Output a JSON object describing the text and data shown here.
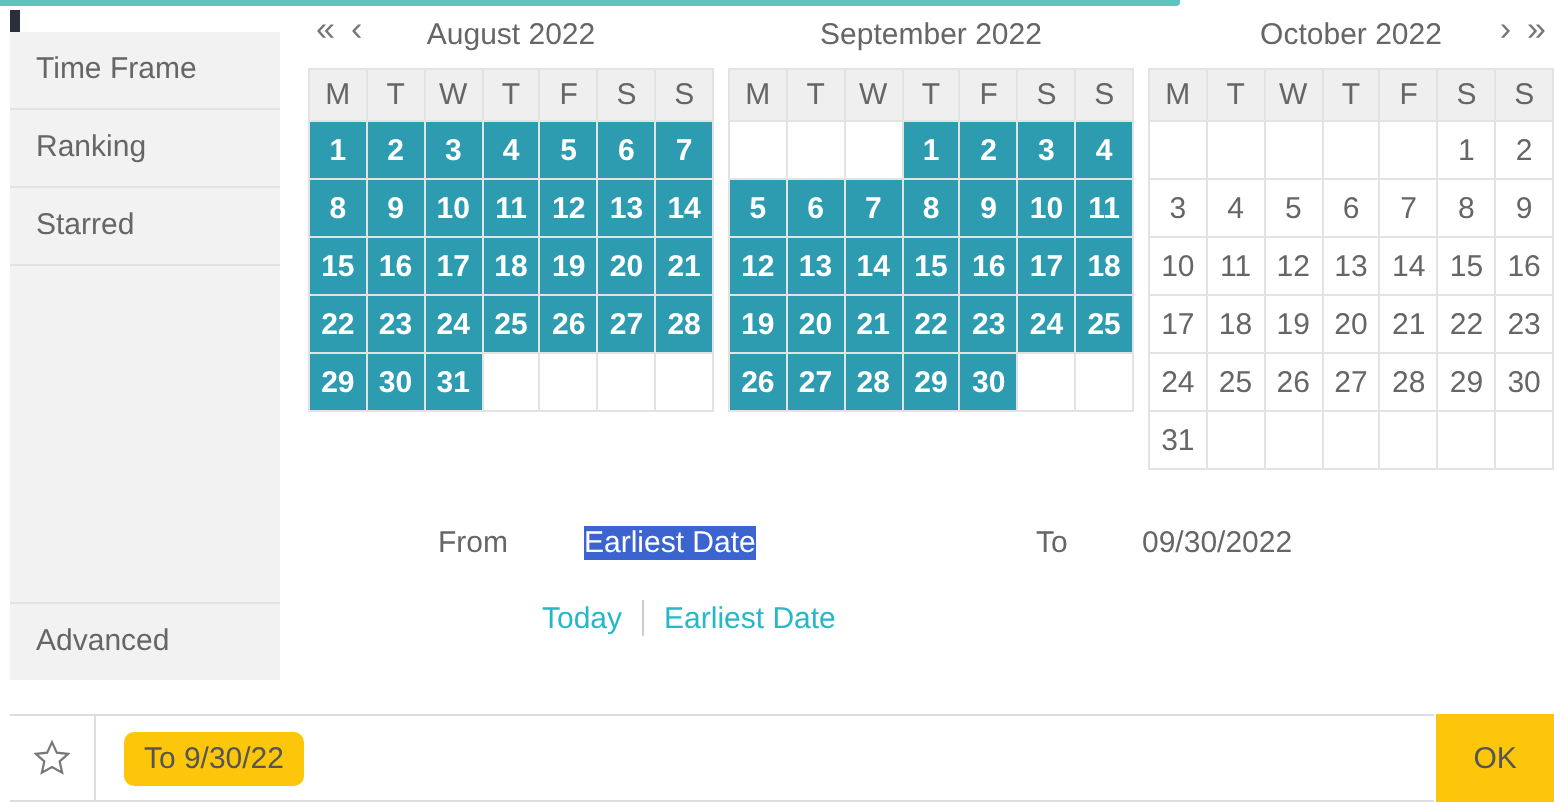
{
  "sidebar": {
    "items": [
      {
        "label": "Time Frame"
      },
      {
        "label": "Ranking"
      },
      {
        "label": "Starred"
      }
    ],
    "footer_item": "Advanced"
  },
  "calendar": {
    "nav": {
      "prev_year": "«",
      "prev_month": "‹",
      "next_month": "›",
      "next_year": "»"
    },
    "months": [
      {
        "title": "August 2022",
        "weekdays": [
          "M",
          "T",
          "W",
          "T",
          "F",
          "S",
          "S"
        ],
        "weeks": [
          [
            {
              "kind": "day",
              "day": "1",
              "selected": true
            },
            {
              "kind": "day",
              "day": "2",
              "selected": true
            },
            {
              "kind": "day",
              "day": "3",
              "selected": true
            },
            {
              "kind": "day",
              "day": "4",
              "selected": true
            },
            {
              "kind": "day",
              "day": "5",
              "selected": true
            },
            {
              "kind": "day",
              "day": "6",
              "selected": true
            },
            {
              "kind": "day",
              "day": "7",
              "selected": true
            }
          ],
          [
            {
              "kind": "day",
              "day": "8",
              "selected": true
            },
            {
              "kind": "day",
              "day": "9",
              "selected": true
            },
            {
              "kind": "day",
              "day": "10",
              "selected": true
            },
            {
              "kind": "day",
              "day": "11",
              "selected": true
            },
            {
              "kind": "day",
              "day": "12",
              "selected": true
            },
            {
              "kind": "day",
              "day": "13",
              "selected": true
            },
            {
              "kind": "day",
              "day": "14",
              "selected": true
            }
          ],
          [
            {
              "kind": "day",
              "day": "15",
              "selected": true
            },
            {
              "kind": "day",
              "day": "16",
              "selected": true
            },
            {
              "kind": "day",
              "day": "17",
              "selected": true
            },
            {
              "kind": "day",
              "day": "18",
              "selected": true
            },
            {
              "kind": "day",
              "day": "19",
              "selected": true
            },
            {
              "kind": "day",
              "day": "20",
              "selected": true
            },
            {
              "kind": "day",
              "day": "21",
              "selected": true
            }
          ],
          [
            {
              "kind": "day",
              "day": "22",
              "selected": true
            },
            {
              "kind": "day",
              "day": "23",
              "selected": true
            },
            {
              "kind": "day",
              "day": "24",
              "selected": true
            },
            {
              "kind": "day",
              "day": "25",
              "selected": true
            },
            {
              "kind": "day",
              "day": "26",
              "selected": true
            },
            {
              "kind": "day",
              "day": "27",
              "selected": true
            },
            {
              "kind": "day",
              "day": "28",
              "selected": true
            }
          ],
          [
            {
              "kind": "day",
              "day": "29",
              "selected": true
            },
            {
              "kind": "day",
              "day": "30",
              "selected": true
            },
            {
              "kind": "day",
              "day": "31",
              "selected": true
            },
            {
              "kind": "blank"
            },
            {
              "kind": "blank"
            },
            {
              "kind": "blank"
            },
            {
              "kind": "blank"
            }
          ]
        ]
      },
      {
        "title": "September 2022",
        "weekdays": [
          "M",
          "T",
          "W",
          "T",
          "F",
          "S",
          "S"
        ],
        "weeks": [
          [
            {
              "kind": "blank"
            },
            {
              "kind": "blank"
            },
            {
              "kind": "blank"
            },
            {
              "kind": "day",
              "day": "1",
              "selected": true
            },
            {
              "kind": "day",
              "day": "2",
              "selected": true
            },
            {
              "kind": "day",
              "day": "3",
              "selected": true
            },
            {
              "kind": "day",
              "day": "4",
              "selected": true
            }
          ],
          [
            {
              "kind": "day",
              "day": "5",
              "selected": true
            },
            {
              "kind": "day",
              "day": "6",
              "selected": true
            },
            {
              "kind": "day",
              "day": "7",
              "selected": true
            },
            {
              "kind": "day",
              "day": "8",
              "selected": true
            },
            {
              "kind": "day",
              "day": "9",
              "selected": true
            },
            {
              "kind": "day",
              "day": "10",
              "selected": true
            },
            {
              "kind": "day",
              "day": "11",
              "selected": true
            }
          ],
          [
            {
              "kind": "day",
              "day": "12",
              "selected": true
            },
            {
              "kind": "day",
              "day": "13",
              "selected": true
            },
            {
              "kind": "day",
              "day": "14",
              "selected": true
            },
            {
              "kind": "day",
              "day": "15",
              "selected": true
            },
            {
              "kind": "day",
              "day": "16",
              "selected": true
            },
            {
              "kind": "day",
              "day": "17",
              "selected": true
            },
            {
              "kind": "day",
              "day": "18",
              "selected": true
            }
          ],
          [
            {
              "kind": "day",
              "day": "19",
              "selected": true
            },
            {
              "kind": "day",
              "day": "20",
              "selected": true
            },
            {
              "kind": "day",
              "day": "21",
              "selected": true
            },
            {
              "kind": "day",
              "day": "22",
              "selected": true
            },
            {
              "kind": "day",
              "day": "23",
              "selected": true
            },
            {
              "kind": "day",
              "day": "24",
              "selected": true
            },
            {
              "kind": "day",
              "day": "25",
              "selected": true
            }
          ],
          [
            {
              "kind": "day",
              "day": "26",
              "selected": true
            },
            {
              "kind": "day",
              "day": "27",
              "selected": true
            },
            {
              "kind": "day",
              "day": "28",
              "selected": true
            },
            {
              "kind": "day",
              "day": "29",
              "selected": true
            },
            {
              "kind": "day",
              "day": "30",
              "selected": true
            },
            {
              "kind": "blank"
            },
            {
              "kind": "blank"
            }
          ]
        ]
      },
      {
        "title": "October 2022",
        "weekdays": [
          "M",
          "T",
          "W",
          "T",
          "F",
          "S",
          "S"
        ],
        "weeks": [
          [
            {
              "kind": "blank"
            },
            {
              "kind": "blank"
            },
            {
              "kind": "blank"
            },
            {
              "kind": "blank"
            },
            {
              "kind": "blank"
            },
            {
              "kind": "day",
              "day": "1",
              "selected": false
            },
            {
              "kind": "day",
              "day": "2",
              "selected": false
            }
          ],
          [
            {
              "kind": "day",
              "day": "3",
              "selected": false
            },
            {
              "kind": "day",
              "day": "4",
              "selected": false
            },
            {
              "kind": "day",
              "day": "5",
              "selected": false
            },
            {
              "kind": "day",
              "day": "6",
              "selected": false
            },
            {
              "kind": "day",
              "day": "7",
              "selected": false
            },
            {
              "kind": "day",
              "day": "8",
              "selected": false
            },
            {
              "kind": "day",
              "day": "9",
              "selected": false
            }
          ],
          [
            {
              "kind": "day",
              "day": "10",
              "selected": false
            },
            {
              "kind": "day",
              "day": "11",
              "selected": false
            },
            {
              "kind": "day",
              "day": "12",
              "selected": false
            },
            {
              "kind": "day",
              "day": "13",
              "selected": false
            },
            {
              "kind": "day",
              "day": "14",
              "selected": false
            },
            {
              "kind": "day",
              "day": "15",
              "selected": false
            },
            {
              "kind": "day",
              "day": "16",
              "selected": false
            }
          ],
          [
            {
              "kind": "day",
              "day": "17",
              "selected": false
            },
            {
              "kind": "day",
              "day": "18",
              "selected": false
            },
            {
              "kind": "day",
              "day": "19",
              "selected": false
            },
            {
              "kind": "day",
              "day": "20",
              "selected": false
            },
            {
              "kind": "day",
              "day": "21",
              "selected": false
            },
            {
              "kind": "day",
              "day": "22",
              "selected": false
            },
            {
              "kind": "day",
              "day": "23",
              "selected": false
            }
          ],
          [
            {
              "kind": "day",
              "day": "24",
              "selected": false
            },
            {
              "kind": "day",
              "day": "25",
              "selected": false
            },
            {
              "kind": "day",
              "day": "26",
              "selected": false
            },
            {
              "kind": "day",
              "day": "27",
              "selected": false
            },
            {
              "kind": "day",
              "day": "28",
              "selected": false
            },
            {
              "kind": "day",
              "day": "29",
              "selected": false
            },
            {
              "kind": "day",
              "day": "30",
              "selected": false
            }
          ],
          [
            {
              "kind": "day",
              "day": "31",
              "selected": false
            },
            {
              "kind": "blank"
            },
            {
              "kind": "blank"
            },
            {
              "kind": "blank"
            },
            {
              "kind": "blank"
            },
            {
              "kind": "blank"
            },
            {
              "kind": "blank"
            }
          ]
        ]
      }
    ]
  },
  "range": {
    "from": {
      "label": "From",
      "value": "Earliest Date",
      "highlighted": true
    },
    "to": {
      "label": "To",
      "value": "09/30/2022",
      "highlighted": false
    }
  },
  "quick_links": [
    "Today",
    "Earliest Date"
  ],
  "bottom_bar": {
    "chip": "To 9/30/22",
    "ok": "OK"
  }
}
